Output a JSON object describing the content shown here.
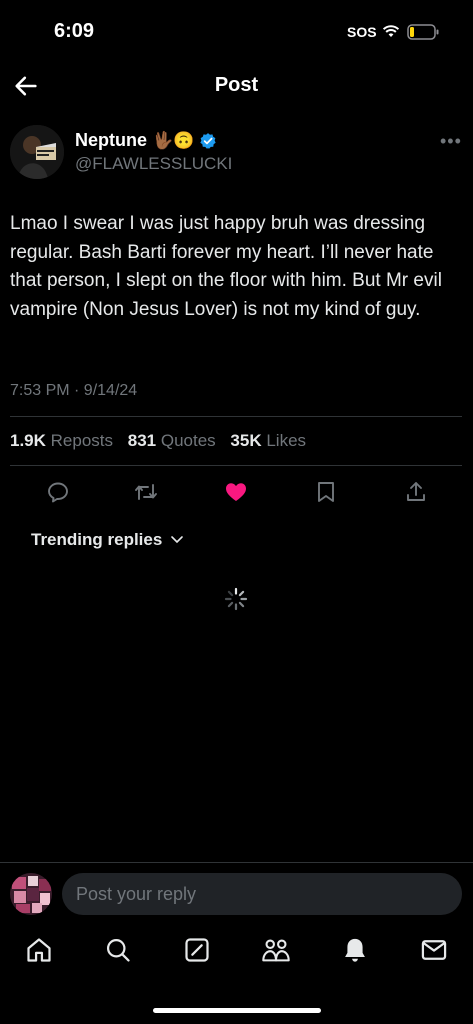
{
  "status_bar": {
    "time": "6:09",
    "carrier": "SOS"
  },
  "nav": {
    "title": "Post"
  },
  "post": {
    "author_name": "Neptune",
    "name_emojis": "🖖🏾🙃",
    "handle": "@FLAWLESSLUCKI",
    "text": "Lmao I swear I was just happy bruh was dressing regular. Bash Barti forever my heart. I’ll never hate that person, I slept on the floor with him. But Mr evil vampire (Non Jesus Lover) is not my kind of guy.",
    "timestamp": "7:53 PM · 9/14/24",
    "stats": {
      "reposts_count": "1.9K",
      "reposts_label": "Reposts",
      "quotes_count": "831",
      "quotes_label": "Quotes",
      "likes_count": "35K",
      "likes_label": "Likes"
    },
    "liked": true
  },
  "replies": {
    "sort_label": "Trending replies"
  },
  "reply_bar": {
    "placeholder": "Post your reply"
  },
  "colors": {
    "background": "#000000",
    "text": "#e7e9ea",
    "secondary": "#71767b",
    "like": "#f91880",
    "verified": "#1d9bf0"
  },
  "icons": {
    "back": "arrow-left-icon",
    "verified": "verified-badge-icon",
    "more": "more-icon",
    "reply": "reply-icon",
    "repost": "repost-icon",
    "like": "heart-icon",
    "bookmark": "bookmark-icon",
    "share": "share-icon",
    "tabs": [
      "home-icon",
      "search-icon",
      "compose-icon",
      "communities-icon",
      "notifications-icon",
      "messages-icon"
    ]
  }
}
